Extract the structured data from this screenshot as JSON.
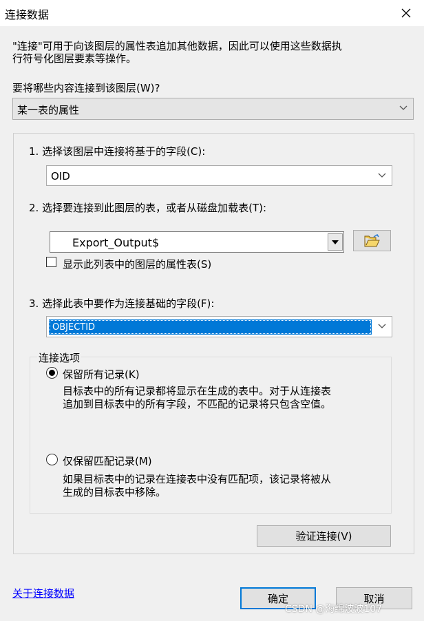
{
  "window": {
    "title": "连接数据"
  },
  "intro": {
    "line1": "\"连接\"可用于向该图层的属性表追加其他数据，因此可以使用这些数据执",
    "line2": "行符号化图层要素等操作。"
  },
  "join_question": {
    "label": "要将哪些内容连接到该图层(W)?",
    "selected": "某一表的属性"
  },
  "step1": {
    "label": "1. 选择该图层中连接将基于的字段(C):",
    "selected": "OID"
  },
  "step2": {
    "label": "2. 选择要连接到此图层的表，或者从磁盘加载表(T):",
    "table_value": "Export_Output$",
    "checkbox_label": "显示此列表中的图层的属性表(S)",
    "checkbox_checked": false
  },
  "step3": {
    "label": "3. 选择此表中要作为连接基础的字段(F):",
    "selected": "OBJECTID"
  },
  "join_options": {
    "title": "连接选项",
    "keep_all": {
      "label": "保留所有记录(K)",
      "selected": true,
      "desc_line1": "目标表中的所有记录都将显示在生成的表中。对于从连接表",
      "desc_line2": "追加到目标表中的所有字段，不匹配的记录将只包含空值。"
    },
    "keep_matching": {
      "label": "仅保留匹配记录(M)",
      "selected": false,
      "desc_line1": "如果目标表中的记录在连接表中没有匹配项，该记录将被从",
      "desc_line2": "生成的目标表中移除。"
    }
  },
  "buttons": {
    "validate": "验证连接(V)",
    "ok": "确定",
    "cancel": "取消"
  },
  "help_link": "关于连接数据",
  "watermark": "CSDN @海绵波波107",
  "colors": {
    "selection": "#0078d7",
    "link": "#0000ff",
    "background": "#f0f0f0"
  }
}
